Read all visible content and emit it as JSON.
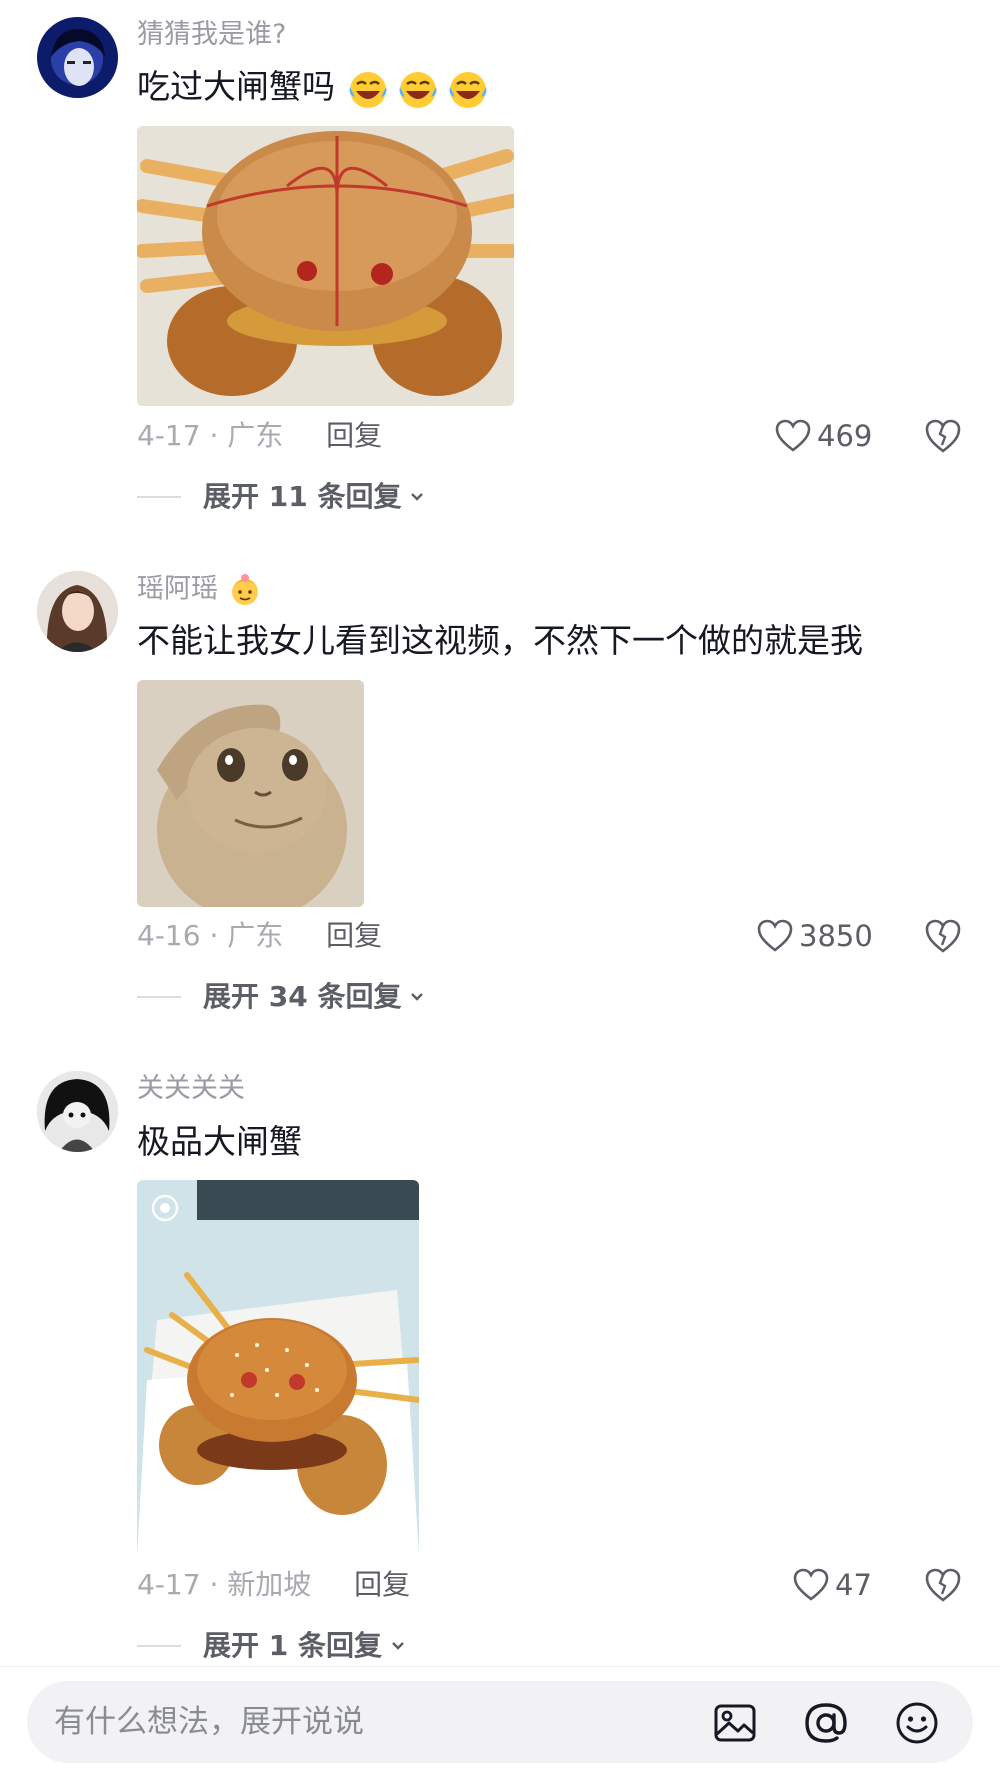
{
  "comments": [
    {
      "username": "猜猜我是谁?",
      "text": "吃过大闸蟹吗",
      "emojis": [
        "face-with-tears-of-joy",
        "face-with-tears-of-joy",
        "face-with-tears-of-joy"
      ],
      "date": "4-17",
      "location": "广东",
      "reply_label": "回复",
      "likes": "469",
      "expand_label": "展开 11 条回复"
    },
    {
      "username": "瑶阿瑶",
      "username_emoji": "baby-girl",
      "text": "不能让我女儿看到这视频，不然下一个做的就是我",
      "date": "4-16",
      "location": "广东",
      "reply_label": "回复",
      "likes": "3850",
      "expand_label": "展开 34 条回复"
    },
    {
      "username": "关关关关",
      "text": "极品大闸蟹",
      "date": "4-17",
      "location": "新加坡",
      "reply_label": "回复",
      "likes": "47",
      "expand_label": "展开 1 条回复"
    }
  ],
  "input": {
    "placeholder": "有什么想法，展开说说"
  },
  "icons": [
    "image-icon",
    "at-icon",
    "emoji-icon",
    "heart-icon",
    "broken-heart-icon",
    "chevron-down-icon"
  ],
  "colors": {
    "secondary_text": "#a8aab0",
    "primary_text": "#161823",
    "input_bg": "#f2f2f4"
  }
}
